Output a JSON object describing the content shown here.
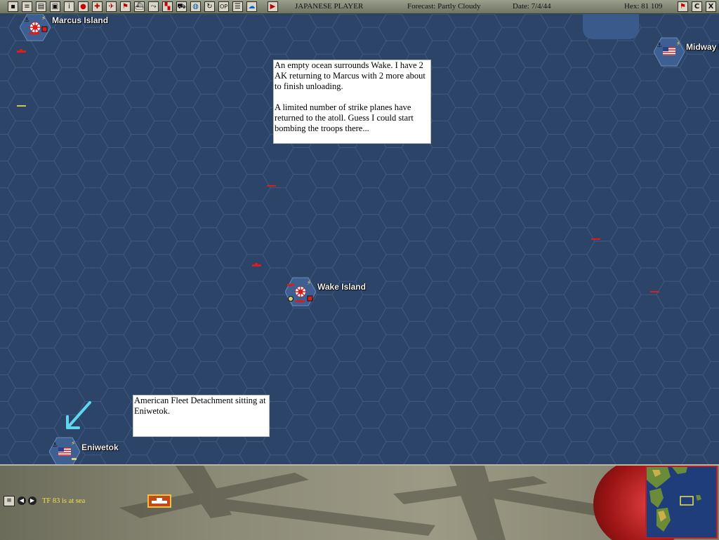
{
  "toolbar": {
    "player": "JAPANESE PLAYER",
    "forecast": "Forecast: Partly Cloudy",
    "date": "Date: 7/4/44",
    "hex": "Hex: 81 109",
    "right_buttons": [
      "flag",
      "C",
      "X"
    ],
    "op_label": "OP"
  },
  "map": {
    "bases": [
      {
        "name": "Marcus Island",
        "side": "japan"
      },
      {
        "name": "Wake Island",
        "side": "japan"
      },
      {
        "name": "Midway I",
        "side": "usa"
      },
      {
        "name": "Eniwetok",
        "side": "usa"
      }
    ],
    "notes": {
      "wake_p1": "An empty ocean surrounds Wake.  I have 2 AK returning to Marcus with 2 more about to finish unloading.",
      "wake_p2": "A limited number of strike planes have returned to the atoll.  Guess I could start bombing the troops there...",
      "eniwetok": "American Fleet Detachment sitting at Eniwetok."
    }
  },
  "panel": {
    "tf_status": "TF 83 is at sea"
  },
  "colors": {
    "ocean": "#2c4468",
    "hex_line": "#3e5a83",
    "japan_red": "#d81e1e",
    "highlight_arrow": "#5fd6ef",
    "status_text": "#f4e04a"
  }
}
